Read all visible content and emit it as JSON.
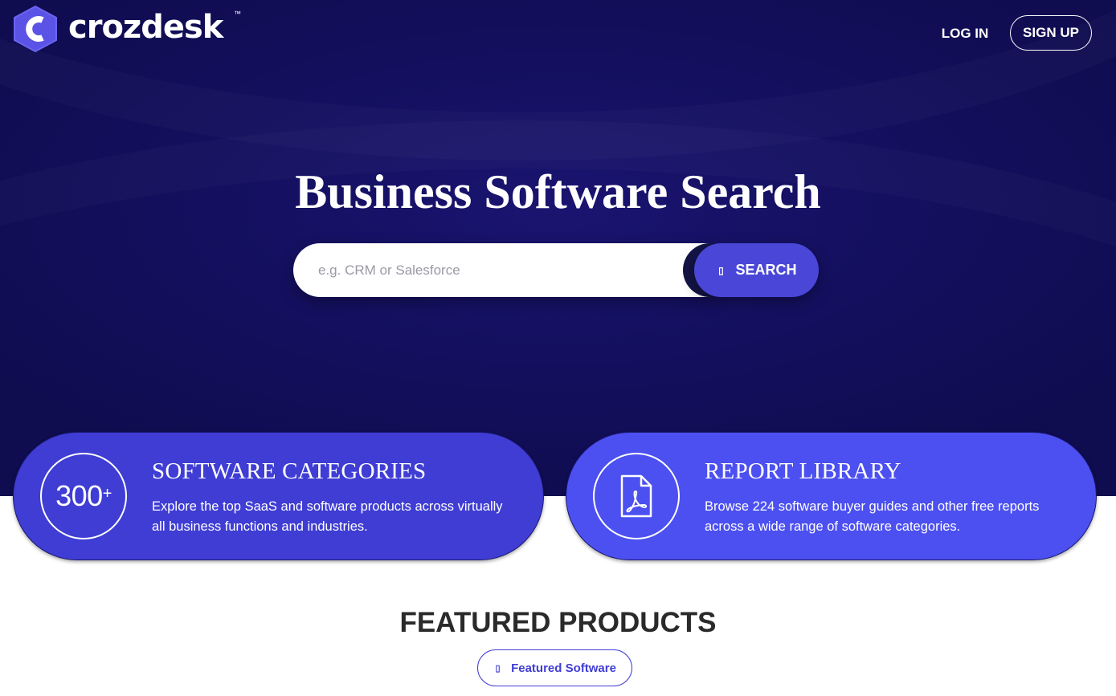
{
  "brand": {
    "name": "crozdesk",
    "trademark": "™"
  },
  "nav": {
    "login_label": "LOG IN",
    "signup_label": "SIGN UP"
  },
  "hero": {
    "title": "Business Software Search",
    "search_placeholder": "e.g. CRM or Salesforce",
    "search_value": "",
    "search_button_label": "SEARCH",
    "search_button_icon": "search-icon-missing-glyph"
  },
  "cards": [
    {
      "badge_number": "300",
      "badge_suffix": "+",
      "title": "SOFTWARE CATEGORIES",
      "description": "Explore the top SaaS and software products across virtually all business functions and industries."
    },
    {
      "icon": "pdf-document-icon",
      "title": "REPORT LIBRARY",
      "description": "Browse 224 software buyer guides and other free reports across a wide range of software categories."
    }
  ],
  "featured": {
    "title": "FEATURED PRODUCTS",
    "pill_label": "Featured Software"
  },
  "colors": {
    "hero_bg": "#130f5c",
    "accent": "#4a47d8",
    "card_left": "#3f3dd4",
    "card_right": "#4c50f0",
    "white": "#ffffff"
  }
}
